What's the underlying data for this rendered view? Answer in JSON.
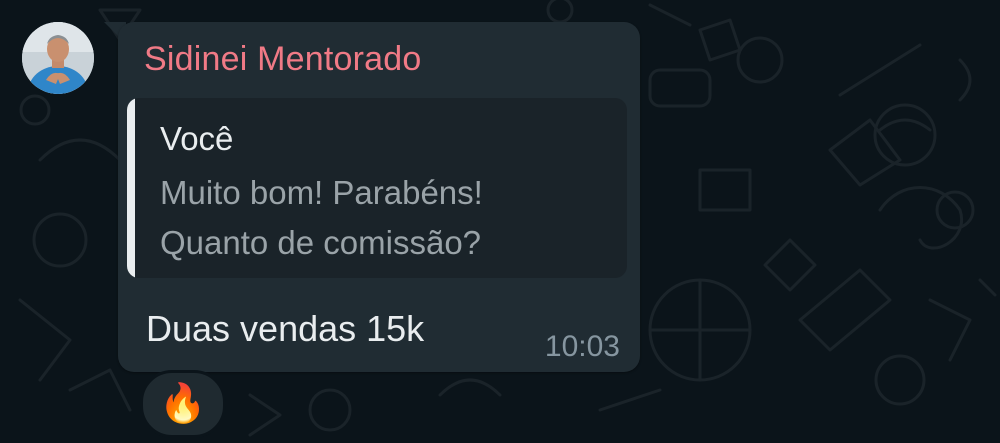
{
  "chat": {
    "sender_name": "Sidinei Mentorado",
    "quoted": {
      "author": "Você",
      "line1": "Muito bom! Parabéns!",
      "line2": "Quanto de comissão?"
    },
    "message": "Duas vendas 15k",
    "time": "10:03",
    "reaction": "🔥",
    "avatar_icon": "person-avatar-icon"
  },
  "colors": {
    "background": "#0b141a",
    "bubble": "#202c33",
    "quote_bg": "#1a2329",
    "sender_name": "#f07a86",
    "quote_bar": "#e9edef",
    "text": "#e9edef",
    "muted": "#9aa3a8",
    "time": "#8696a0"
  }
}
